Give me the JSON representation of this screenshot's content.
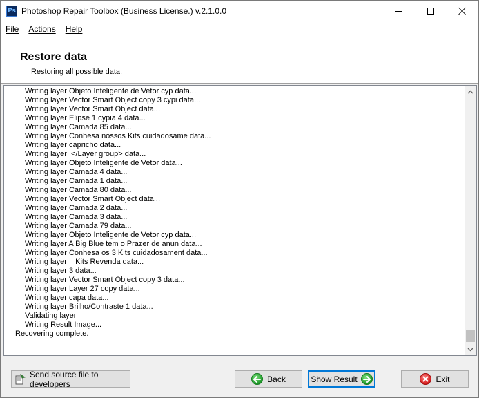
{
  "window": {
    "title": "Photoshop Repair Toolbox (Business License.) v.2.1.0.0",
    "icon_text": "Ps"
  },
  "menu": {
    "items": [
      {
        "label": "File"
      },
      {
        "label": "Actions"
      },
      {
        "label": "Help"
      }
    ]
  },
  "header": {
    "title": "Restore data",
    "subtitle": "Restoring all possible data."
  },
  "log": {
    "lines": [
      {
        "text": "Writing layer Objeto Inteligente de Vetor cyp data...",
        "indent": true
      },
      {
        "text": "Writing layer Vector Smart Object copy 3 cypi data...",
        "indent": true
      },
      {
        "text": "Writing layer Vector Smart Object data...",
        "indent": true
      },
      {
        "text": "Writing layer Elipse 1 cypia 4 data...",
        "indent": true
      },
      {
        "text": "Writing layer Camada 85 data...",
        "indent": true
      },
      {
        "text": "Writing layer Conhesa nossos Kits cuidadosame data...",
        "indent": true
      },
      {
        "text": "Writing layer capricho data...",
        "indent": true
      },
      {
        "text": "Writing layer  </Layer group> data...",
        "indent": true
      },
      {
        "text": "Writing layer Objeto Inteligente de Vetor data...",
        "indent": true
      },
      {
        "text": "Writing layer Camada 4 data...",
        "indent": true
      },
      {
        "text": "Writing layer Camada 1 data...",
        "indent": true
      },
      {
        "text": "Writing layer Camada 80 data...",
        "indent": true
      },
      {
        "text": "Writing layer Vector Smart Object data...",
        "indent": true
      },
      {
        "text": "Writing layer Camada 2 data...",
        "indent": true
      },
      {
        "text": "Writing layer Camada 3 data...",
        "indent": true
      },
      {
        "text": "Writing layer Camada 79 data...",
        "indent": true
      },
      {
        "text": "Writing layer Objeto Inteligente de Vetor cyp data...",
        "indent": true
      },
      {
        "text": "Writing layer A Big Blue tem o Prazer de anun data...",
        "indent": true
      },
      {
        "text": "Writing layer Conhesa os 3 Kits cuidadosament data...",
        "indent": true
      },
      {
        "text": "Writing layer    Kits Revenda data...",
        "indent": true
      },
      {
        "text": "Writing layer 3 data...",
        "indent": true
      },
      {
        "text": "Writing layer Vector Smart Object copy 3 data...",
        "indent": true
      },
      {
        "text": "Writing layer Layer 27 copy data...",
        "indent": true
      },
      {
        "text": "Writing layer capa data...",
        "indent": true
      },
      {
        "text": "Writing layer Brilho/Contraste 1 data...",
        "indent": true
      },
      {
        "text": "Validating layer",
        "indent": true
      },
      {
        "text": "Writing Result Image...",
        "indent": true
      },
      {
        "text": "Recovering complete.",
        "indent": false
      }
    ]
  },
  "buttons": {
    "send": "Send source file to developers",
    "back": "Back",
    "show_result": "Show Result",
    "exit": "Exit"
  },
  "colors": {
    "accent": "#0078d7",
    "go_green": "#1f9a2a",
    "exit_red": "#d61e1e"
  }
}
